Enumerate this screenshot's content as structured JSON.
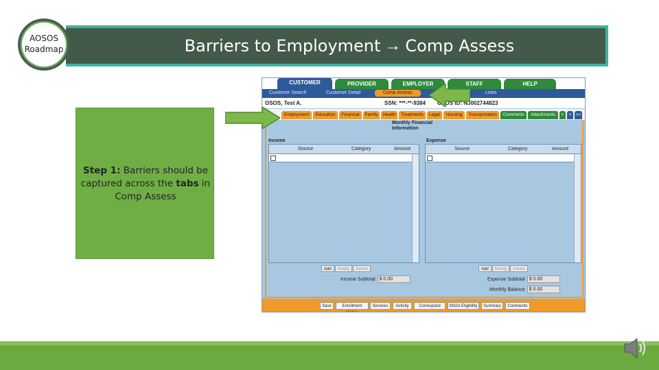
{
  "badge": {
    "line1": "AOSOS",
    "line2": "Roadmap"
  },
  "title": {
    "left": "Barriers to Employment",
    "arrow": "→",
    "right": "Comp Assess"
  },
  "callout": {
    "step_label": "Step 1:",
    "text_a": "Barriers should be captured across the",
    "text_bold": "tabs",
    "text_b": "in Comp Assess"
  },
  "app": {
    "top_tabs": [
      "CUSTOMER",
      "PROVIDER",
      "EMPLOYER",
      "STAFF",
      "HELP"
    ],
    "nav_items": [
      "Customer Search",
      "Customer Detail",
      "Comp Assess",
      "Links"
    ],
    "customer": {
      "name": "OSOS, Test A.",
      "ssn": "SSN: ***-**-9384",
      "osos_id": "OSOS ID: NJ002744823"
    },
    "sub_tabs": [
      "Employment",
      "Education",
      "Financial",
      "Family",
      "Health",
      "Treatments",
      "Legal",
      "Housing",
      "Transportation",
      "Comments",
      "Attachments"
    ],
    "sub_nav": [
      "<",
      ">",
      ">>"
    ],
    "section_title": "Monthly Financial Information",
    "income": {
      "label": "Income",
      "columns": [
        "Source",
        "Category",
        "Amount"
      ],
      "buttons": [
        "Add",
        "Modify",
        "Delete"
      ],
      "subtotal_label": "Income Subtotal",
      "subtotal_value": "$ 0.00"
    },
    "expense": {
      "label": "Expense",
      "columns": [
        "Source",
        "Category",
        "Amount"
      ],
      "buttons": [
        "Add",
        "Modify",
        "Delete"
      ],
      "subtotal_label": "Expense Subtotal",
      "subtotal_value": "$ 0.00",
      "balance_label": "Monthly Balance",
      "balance_value": "$ 0.00"
    },
    "bottom_buttons": [
      "Save",
      "Enrollment History",
      "Services",
      "Activity",
      "Correspond",
      "WIOA Eligibility",
      "Summary",
      "Comments"
    ]
  },
  "colors": {
    "title_bg": "#435a4b",
    "title_border": "#3bb3a2",
    "callout_bg": "#6fae45",
    "footer": "#6aaa3f",
    "app_blue": "#2f5a9a",
    "app_orange": "#f19a28",
    "app_green": "#2f8a3b"
  },
  "icons": [
    "arrow-right-icon",
    "speaker-icon"
  ]
}
